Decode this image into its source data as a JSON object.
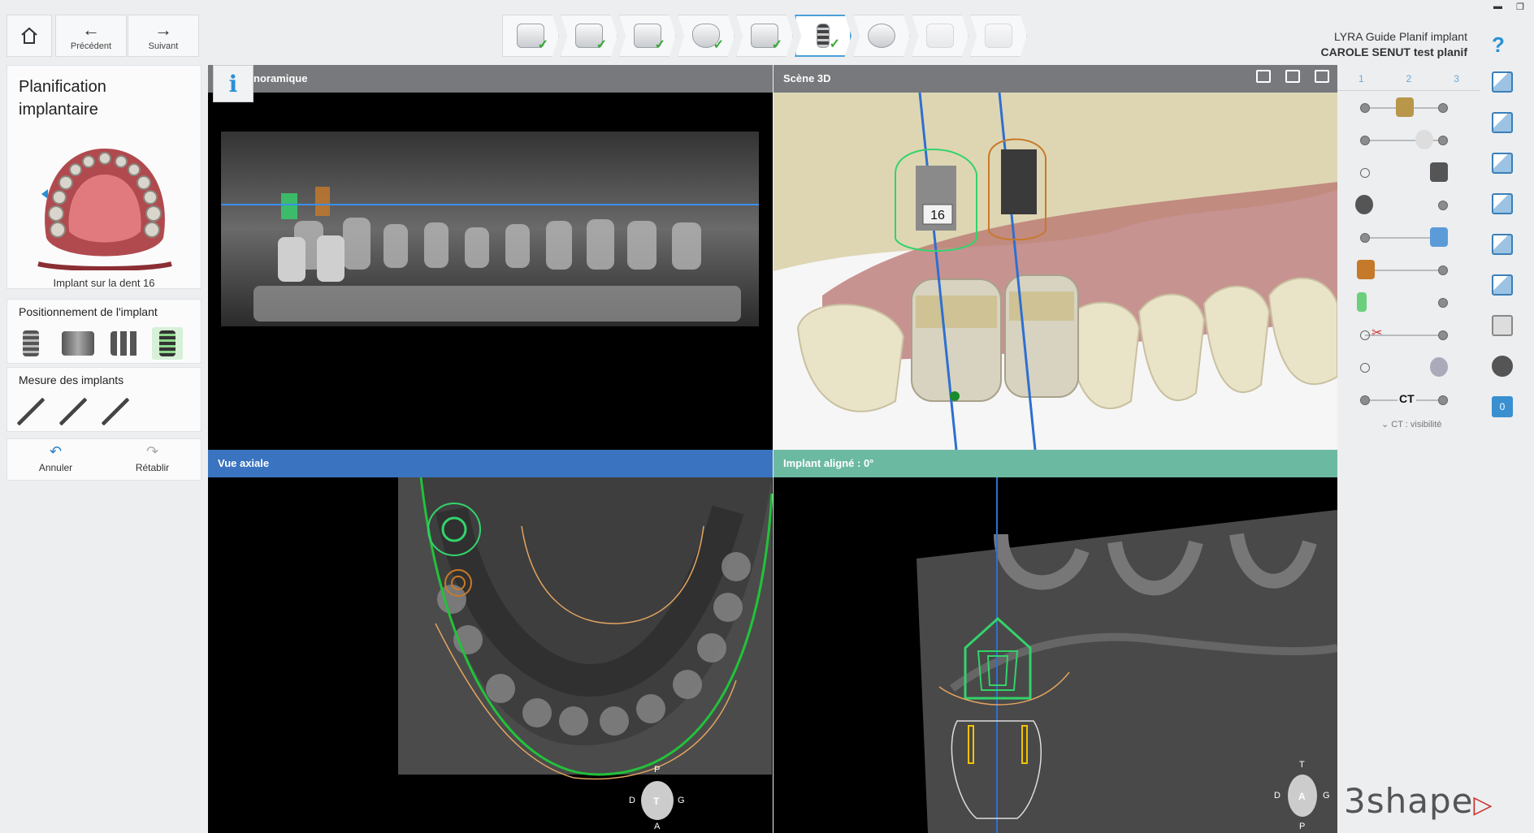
{
  "toolbar": {
    "home_label": "",
    "prev_label": "Précédent",
    "next_label": "Suivant"
  },
  "wizard_steps": [
    {
      "icon": "order-form-icon",
      "done": true
    },
    {
      "icon": "scan-import-icon",
      "done": true
    },
    {
      "icon": "segmentation-icon",
      "done": true
    },
    {
      "icon": "crown-icon",
      "done": true
    },
    {
      "icon": "jaw-alignment-icon",
      "done": true
    },
    {
      "icon": "implant-icon",
      "done": true,
      "active": true
    },
    {
      "icon": "sleeve-icon",
      "done": false
    },
    {
      "icon": "guide-design-icon",
      "done": false,
      "disabled": true
    },
    {
      "icon": "output-icon",
      "done": false,
      "disabled": true
    }
  ],
  "project": {
    "name": "LYRA Guide Planif implant",
    "patient": "CAROLE SENUT test planif"
  },
  "left_panel": {
    "title_line1": "Planification",
    "title_line2": "implantaire",
    "caption": "Implant sur la dent 16",
    "positioning_title": "Positionnement de l'implant",
    "measure_title": "Mesure des implants",
    "undo_label": "Annuler",
    "redo_label": "Rétablir"
  },
  "viewports": {
    "panoramic_title": "Panoramique",
    "panoramic_visible_title": "noramique",
    "scene3d_title": "Scène 3D",
    "axial_title": "Vue axiale",
    "aligned_title": "Implant aligné : 0°",
    "tooth_label": "16"
  },
  "orientation_axial": {
    "top": "P",
    "left": "D",
    "center": "T",
    "right": "G",
    "bottom": "A"
  },
  "orientation_aligned": {
    "top": "T",
    "left": "D",
    "center": "A",
    "right": "G",
    "bottom": "P"
  },
  "right_panel": {
    "tabs": [
      "1",
      "2",
      "3"
    ],
    "ct_label": "CT",
    "ct_visibility": "CT : visibilité",
    "badge_count": "0"
  },
  "brand": "3shape",
  "colors": {
    "accent": "#2a8fd6",
    "check": "#3aa83a",
    "axial_header": "#3a74c0",
    "aligned_header": "#6cb9a2",
    "implant_green": "#33d36b",
    "implant_orange": "#c87a2a"
  }
}
